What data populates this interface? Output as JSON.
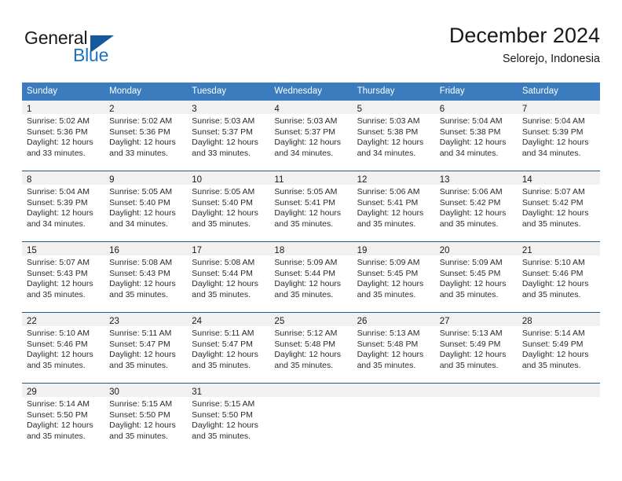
{
  "brand": {
    "name_part1": "General",
    "name_part2": "Blue",
    "triangle_icon": "blue-triangle-logo-mark",
    "color_dark": "#1a1a1a",
    "color_blue": "#1d72bc"
  },
  "header": {
    "title": "December 2024",
    "subtitle": "Selorejo, Indonesia"
  },
  "theme": {
    "header_row_bg": "#3a7cbe",
    "header_row_text": "#ffffff",
    "week_divider": "#1b5e9e",
    "daynum_band_bg": "#f1f1f1",
    "body_text": "#2b2b2b"
  },
  "weekdays": [
    "Sunday",
    "Monday",
    "Tuesday",
    "Wednesday",
    "Thursday",
    "Friday",
    "Saturday"
  ],
  "weeks": [
    [
      {
        "day": "1",
        "sunrise": "Sunrise: 5:02 AM",
        "sunset": "Sunset: 5:36 PM",
        "daylight1": "Daylight: 12 hours",
        "daylight2": "and 33 minutes."
      },
      {
        "day": "2",
        "sunrise": "Sunrise: 5:02 AM",
        "sunset": "Sunset: 5:36 PM",
        "daylight1": "Daylight: 12 hours",
        "daylight2": "and 33 minutes."
      },
      {
        "day": "3",
        "sunrise": "Sunrise: 5:03 AM",
        "sunset": "Sunset: 5:37 PM",
        "daylight1": "Daylight: 12 hours",
        "daylight2": "and 33 minutes."
      },
      {
        "day": "4",
        "sunrise": "Sunrise: 5:03 AM",
        "sunset": "Sunset: 5:37 PM",
        "daylight1": "Daylight: 12 hours",
        "daylight2": "and 34 minutes."
      },
      {
        "day": "5",
        "sunrise": "Sunrise: 5:03 AM",
        "sunset": "Sunset: 5:38 PM",
        "daylight1": "Daylight: 12 hours",
        "daylight2": "and 34 minutes."
      },
      {
        "day": "6",
        "sunrise": "Sunrise: 5:04 AM",
        "sunset": "Sunset: 5:38 PM",
        "daylight1": "Daylight: 12 hours",
        "daylight2": "and 34 minutes."
      },
      {
        "day": "7",
        "sunrise": "Sunrise: 5:04 AM",
        "sunset": "Sunset: 5:39 PM",
        "daylight1": "Daylight: 12 hours",
        "daylight2": "and 34 minutes."
      }
    ],
    [
      {
        "day": "8",
        "sunrise": "Sunrise: 5:04 AM",
        "sunset": "Sunset: 5:39 PM",
        "daylight1": "Daylight: 12 hours",
        "daylight2": "and 34 minutes."
      },
      {
        "day": "9",
        "sunrise": "Sunrise: 5:05 AM",
        "sunset": "Sunset: 5:40 PM",
        "daylight1": "Daylight: 12 hours",
        "daylight2": "and 34 minutes."
      },
      {
        "day": "10",
        "sunrise": "Sunrise: 5:05 AM",
        "sunset": "Sunset: 5:40 PM",
        "daylight1": "Daylight: 12 hours",
        "daylight2": "and 35 minutes."
      },
      {
        "day": "11",
        "sunrise": "Sunrise: 5:05 AM",
        "sunset": "Sunset: 5:41 PM",
        "daylight1": "Daylight: 12 hours",
        "daylight2": "and 35 minutes."
      },
      {
        "day": "12",
        "sunrise": "Sunrise: 5:06 AM",
        "sunset": "Sunset: 5:41 PM",
        "daylight1": "Daylight: 12 hours",
        "daylight2": "and 35 minutes."
      },
      {
        "day": "13",
        "sunrise": "Sunrise: 5:06 AM",
        "sunset": "Sunset: 5:42 PM",
        "daylight1": "Daylight: 12 hours",
        "daylight2": "and 35 minutes."
      },
      {
        "day": "14",
        "sunrise": "Sunrise: 5:07 AM",
        "sunset": "Sunset: 5:42 PM",
        "daylight1": "Daylight: 12 hours",
        "daylight2": "and 35 minutes."
      }
    ],
    [
      {
        "day": "15",
        "sunrise": "Sunrise: 5:07 AM",
        "sunset": "Sunset: 5:43 PM",
        "daylight1": "Daylight: 12 hours",
        "daylight2": "and 35 minutes."
      },
      {
        "day": "16",
        "sunrise": "Sunrise: 5:08 AM",
        "sunset": "Sunset: 5:43 PM",
        "daylight1": "Daylight: 12 hours",
        "daylight2": "and 35 minutes."
      },
      {
        "day": "17",
        "sunrise": "Sunrise: 5:08 AM",
        "sunset": "Sunset: 5:44 PM",
        "daylight1": "Daylight: 12 hours",
        "daylight2": "and 35 minutes."
      },
      {
        "day": "18",
        "sunrise": "Sunrise: 5:09 AM",
        "sunset": "Sunset: 5:44 PM",
        "daylight1": "Daylight: 12 hours",
        "daylight2": "and 35 minutes."
      },
      {
        "day": "19",
        "sunrise": "Sunrise: 5:09 AM",
        "sunset": "Sunset: 5:45 PM",
        "daylight1": "Daylight: 12 hours",
        "daylight2": "and 35 minutes."
      },
      {
        "day": "20",
        "sunrise": "Sunrise: 5:09 AM",
        "sunset": "Sunset: 5:45 PM",
        "daylight1": "Daylight: 12 hours",
        "daylight2": "and 35 minutes."
      },
      {
        "day": "21",
        "sunrise": "Sunrise: 5:10 AM",
        "sunset": "Sunset: 5:46 PM",
        "daylight1": "Daylight: 12 hours",
        "daylight2": "and 35 minutes."
      }
    ],
    [
      {
        "day": "22",
        "sunrise": "Sunrise: 5:10 AM",
        "sunset": "Sunset: 5:46 PM",
        "daylight1": "Daylight: 12 hours",
        "daylight2": "and 35 minutes."
      },
      {
        "day": "23",
        "sunrise": "Sunrise: 5:11 AM",
        "sunset": "Sunset: 5:47 PM",
        "daylight1": "Daylight: 12 hours",
        "daylight2": "and 35 minutes."
      },
      {
        "day": "24",
        "sunrise": "Sunrise: 5:11 AM",
        "sunset": "Sunset: 5:47 PM",
        "daylight1": "Daylight: 12 hours",
        "daylight2": "and 35 minutes."
      },
      {
        "day": "25",
        "sunrise": "Sunrise: 5:12 AM",
        "sunset": "Sunset: 5:48 PM",
        "daylight1": "Daylight: 12 hours",
        "daylight2": "and 35 minutes."
      },
      {
        "day": "26",
        "sunrise": "Sunrise: 5:13 AM",
        "sunset": "Sunset: 5:48 PM",
        "daylight1": "Daylight: 12 hours",
        "daylight2": "and 35 minutes."
      },
      {
        "day": "27",
        "sunrise": "Sunrise: 5:13 AM",
        "sunset": "Sunset: 5:49 PM",
        "daylight1": "Daylight: 12 hours",
        "daylight2": "and 35 minutes."
      },
      {
        "day": "28",
        "sunrise": "Sunrise: 5:14 AM",
        "sunset": "Sunset: 5:49 PM",
        "daylight1": "Daylight: 12 hours",
        "daylight2": "and 35 minutes."
      }
    ],
    [
      {
        "day": "29",
        "sunrise": "Sunrise: 5:14 AM",
        "sunset": "Sunset: 5:50 PM",
        "daylight1": "Daylight: 12 hours",
        "daylight2": "and 35 minutes."
      },
      {
        "day": "30",
        "sunrise": "Sunrise: 5:15 AM",
        "sunset": "Sunset: 5:50 PM",
        "daylight1": "Daylight: 12 hours",
        "daylight2": "and 35 minutes."
      },
      {
        "day": "31",
        "sunrise": "Sunrise: 5:15 AM",
        "sunset": "Sunset: 5:50 PM",
        "daylight1": "Daylight: 12 hours",
        "daylight2": "and 35 minutes."
      },
      {
        "day": "",
        "sunrise": "",
        "sunset": "",
        "daylight1": "",
        "daylight2": ""
      },
      {
        "day": "",
        "sunrise": "",
        "sunset": "",
        "daylight1": "",
        "daylight2": ""
      },
      {
        "day": "",
        "sunrise": "",
        "sunset": "",
        "daylight1": "",
        "daylight2": ""
      },
      {
        "day": "",
        "sunrise": "",
        "sunset": "",
        "daylight1": "",
        "daylight2": ""
      }
    ]
  ]
}
